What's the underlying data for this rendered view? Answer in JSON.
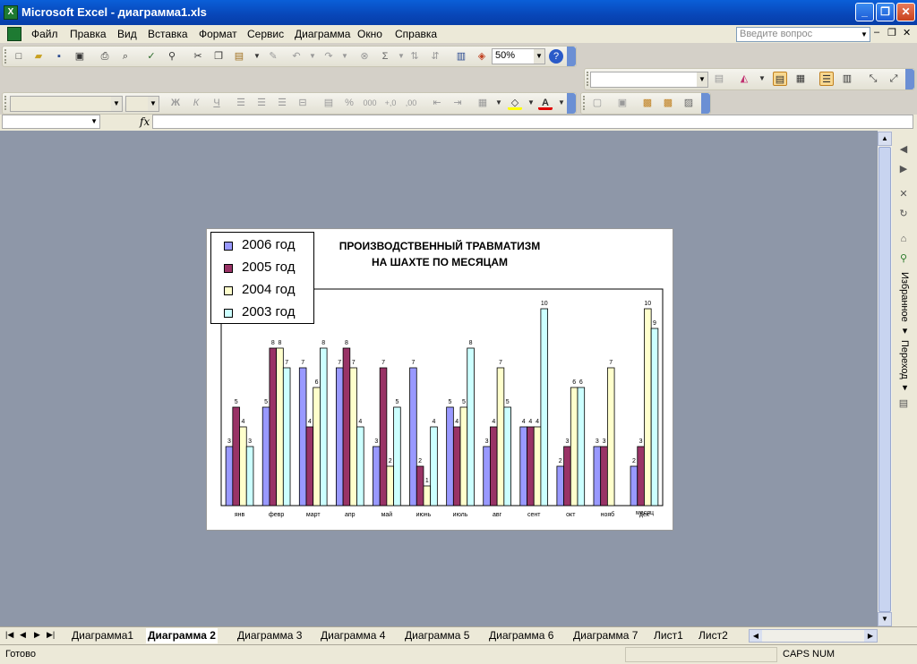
{
  "window": {
    "title": "Microsoft Excel - диаграмма1.xls",
    "min": "_",
    "max": "❐",
    "close": "✕"
  },
  "menu": [
    "Файл",
    "Правка",
    "Вид",
    "Вставка",
    "Формат",
    "Сервис",
    "Диаграмма",
    "Окно",
    "Справка"
  ],
  "ask": {
    "placeholder": "Введите вопрос"
  },
  "toolbar": {
    "zoom": "50%"
  },
  "sheets": [
    "Диаграмма1",
    "Диаграмма 2",
    "Диаграмма 3",
    "Диаграмма 4",
    "Диаграмма 5",
    "Диаграмма 6",
    "Диаграмма 7",
    "Лист1",
    "Лист2"
  ],
  "active_sheet": "Диаграмма 2",
  "status": {
    "ready": "Готово",
    "caps": "CAPS NUM"
  },
  "pane": {
    "favorites": "Избранное ▾",
    "goto": "Переход ▾"
  },
  "chart_data": {
    "type": "bar",
    "title": "ПРОИЗВОДСТВЕННЫЙ ТРАВМАТИЗМ",
    "subtitle": "НА ШАХТЕ ПО МЕСЯЦАМ",
    "xlabel": "месяц",
    "categories": [
      "янв",
      "февр",
      "март",
      "апр",
      "май",
      "июнь",
      "июль",
      "авг",
      "сент",
      "окт",
      "нояб",
      "дек"
    ],
    "legend_position": "top-left",
    "ylim": [
      0,
      11
    ],
    "grid": false,
    "series": [
      {
        "name": "2006 год",
        "color": "#9999ff",
        "values": [
          3,
          5,
          7,
          7,
          3,
          7,
          5,
          3,
          4,
          2,
          3,
          2
        ],
        "labels": [
          "3",
          "5",
          "7",
          "7",
          "3",
          "7",
          "5",
          "3",
          "4",
          "2",
          "3",
          "2"
        ]
      },
      {
        "name": "2005 год",
        "color": "#993366",
        "values": [
          5,
          8,
          4,
          8,
          7,
          2,
          4,
          4,
          4,
          3,
          3,
          3
        ],
        "labels": [
          "5",
          "8",
          "4",
          "8",
          "7",
          "2",
          "4",
          "4",
          "4",
          "3",
          "3",
          "3"
        ]
      },
      {
        "name": "2004 год",
        "color": "#ffffcc",
        "values": [
          4,
          8,
          6,
          7,
          2,
          1,
          5,
          7,
          4,
          6,
          7,
          10
        ],
        "labels": [
          "4",
          "8",
          "6",
          "7",
          "2",
          "1",
          "5",
          "7",
          "4",
          "6",
          "7",
          "10"
        ]
      },
      {
        "name": "2003 год",
        "color": "#ccffff",
        "values": [
          3,
          7,
          8,
          4,
          5,
          4,
          8,
          5,
          10,
          6,
          0,
          9
        ],
        "labels": [
          "3",
          "7",
          "8",
          "4",
          "5",
          "4",
          "8",
          "5",
          "10",
          "6",
          "",
          "9"
        ]
      }
    ]
  }
}
